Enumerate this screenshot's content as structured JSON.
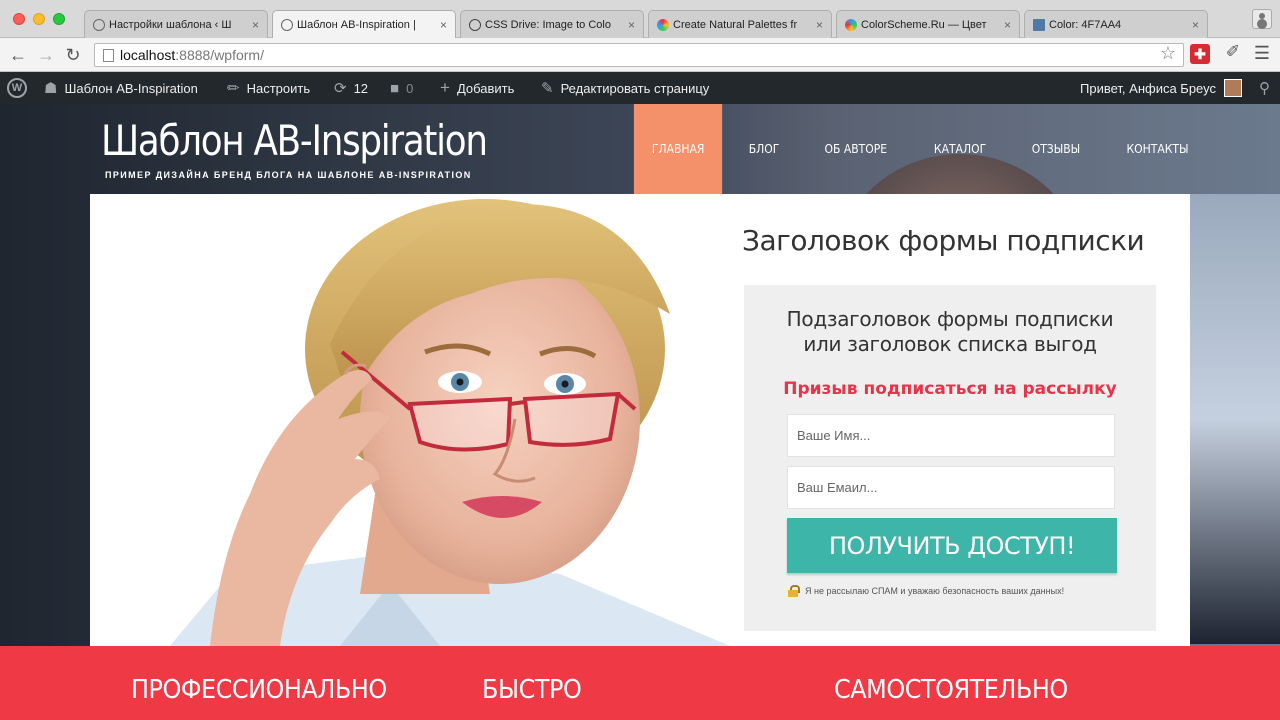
{
  "browser": {
    "tabs": [
      {
        "label": "Настройки шаблона ‹ Ш",
        "active": false
      },
      {
        "label": "Шаблон AB-Inspiration |",
        "active": true
      },
      {
        "label": "CSS Drive: Image to Colo",
        "active": false
      },
      {
        "label": "Create Natural Palettes fr",
        "active": false
      },
      {
        "label": "ColorScheme.Ru — Цвет",
        "active": false
      },
      {
        "label": "Color: 4F7AA4",
        "active": false
      }
    ],
    "close_glyph": "×",
    "url_host": "localhost",
    "url_path": ":8888/wpform/"
  },
  "admin_bar": {
    "wp_logo": "W",
    "site_name": "Шаблон AB-Inspiration",
    "customize": "Настроить",
    "updates_count": "12",
    "comments_count": "0",
    "add_new": "Добавить",
    "edit_page": "Редактировать страницу",
    "greeting": "Привет, Анфиса Бреус"
  },
  "site": {
    "title": "Шаблон AB-Inspiration",
    "tagline": "ПРИМЕР ДИЗАЙНА БРЕНД БЛОГА НА ШАБЛОНЕ AB-INSPIRATION",
    "nav": [
      {
        "label": "ГЛАВНАЯ",
        "active": true
      },
      {
        "label": "БЛОГ",
        "active": false
      },
      {
        "label": "ОБ АВТОРЕ",
        "active": false
      },
      {
        "label": "КАТАЛОГ",
        "active": false
      },
      {
        "label": "ОТЗЫВЫ",
        "active": false
      },
      {
        "label": "КОНТАКТЫ",
        "active": false
      }
    ]
  },
  "form": {
    "title": "Заголовок формы подписки",
    "subtitle_line1": "Подзаголовок формы подписки",
    "subtitle_line2": "или заголовок списка выгод",
    "cta": "Призыв подписаться на рассылку",
    "name_placeholder": "Ваше Имя...",
    "email_placeholder": "Ваш Емаил...",
    "submit_label": "ПОЛУЧИТЬ ДОСТУП!",
    "privacy_note": "Я не рассылаю СПАМ и уважаю безопасность ваших данных!"
  },
  "benefits": [
    "ПРОФЕССИОНАЛЬНО",
    "БЫСТРО",
    "САМОСТОЯТЕЛЬНО"
  ],
  "colors": {
    "nav_active": "#f4916b",
    "cta_text": "#e8344a",
    "submit_button": "#3db5a8",
    "benefits_bar": "#ef3a46",
    "admin_bar": "#23282d"
  }
}
